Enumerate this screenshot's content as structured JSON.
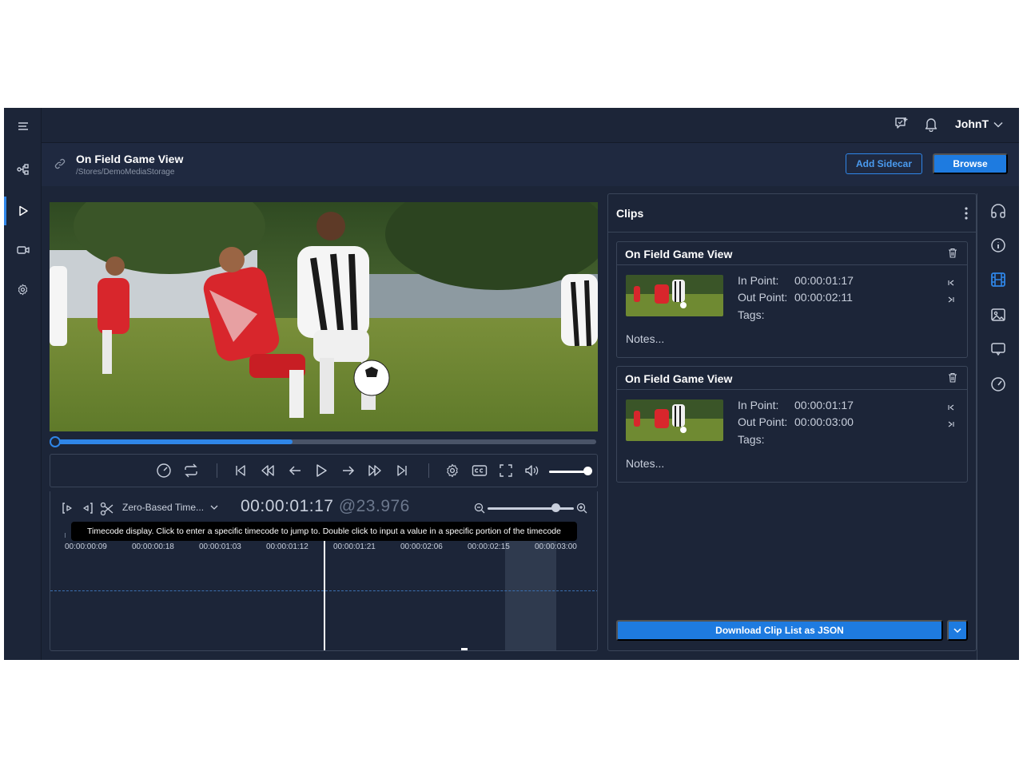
{
  "topbar": {
    "username": "JohnT",
    "icons": [
      "feedback-icon",
      "bell-icon",
      "chevron-down-icon"
    ]
  },
  "leftnav": {
    "icons": [
      "menu-icon",
      "workflow-icon",
      "play-icon",
      "camera-icon",
      "gear-icon"
    ],
    "active": "play-icon"
  },
  "header": {
    "title": "On Field Game View",
    "path": "/Stores/DemoMediaStorage",
    "add_sidecar_label": "Add Sidecar",
    "browse_label": "Browse"
  },
  "player": {
    "progress_fraction": 0.44
  },
  "timeline": {
    "timecode_mode": "Zero-Based Time...",
    "timecode_parts": [
      "00",
      "00",
      "01",
      "17"
    ],
    "fps": "@23.976",
    "tooltip": "Timecode display. Click to enter a specific timecode to jump to. Double click to input a value in a specific portion of the timecode",
    "ruler_labels": [
      "00:00:00:09",
      "00:00:00:18",
      "00:00:01:03",
      "00:00:01:12",
      "00:00:01:21",
      "00:00:02:06",
      "00:00:02:15",
      "00:00:03:00"
    ]
  },
  "clips": {
    "title": "Clips",
    "items": [
      {
        "title": "On Field Game View",
        "in_label": "In Point:",
        "in_value": "00:00:01:17",
        "out_label": "Out Point:",
        "out_value": "00:00:02:11",
        "tags_label": "Tags:",
        "notes": "Notes..."
      },
      {
        "title": "On Field Game View",
        "in_label": "In Point:",
        "in_value": "00:00:01:17",
        "out_label": "Out Point:",
        "out_value": "00:00:03:00",
        "tags_label": "Tags:",
        "notes": "Notes..."
      }
    ],
    "download_label": "Download Clip List as JSON"
  },
  "rightbar": {
    "icons": [
      "headphones-icon",
      "info-icon",
      "film-icon",
      "image-icon",
      "comment-icon",
      "gauge-icon"
    ],
    "active": "film-icon"
  },
  "colors": {
    "accent": "#1e7be0",
    "background": "#1c2538"
  }
}
